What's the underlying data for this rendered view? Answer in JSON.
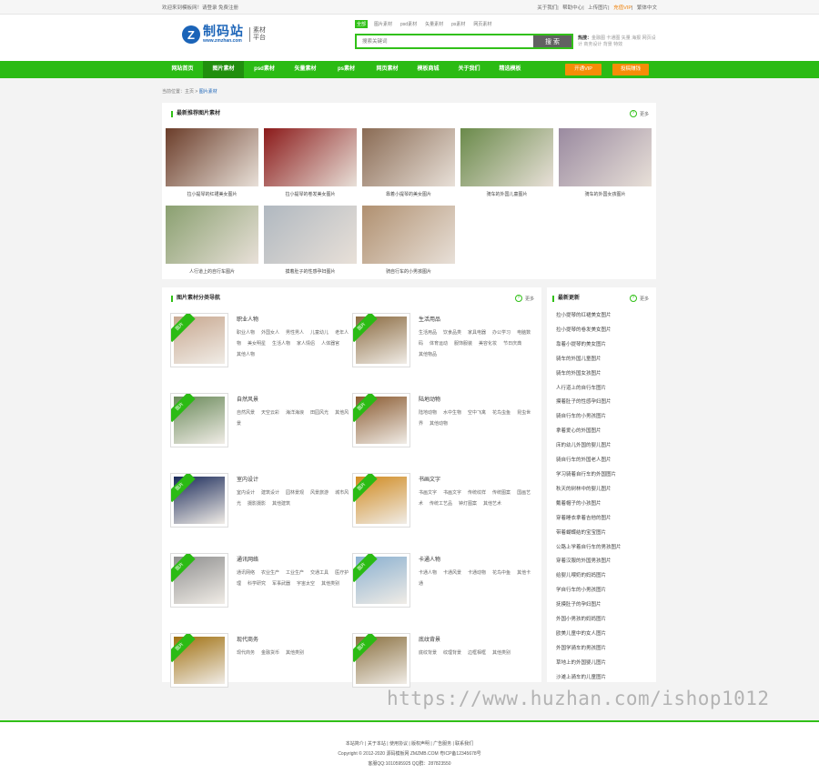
{
  "topbar": {
    "welcome": "欢迎来到模板网！请登录 免费注册",
    "links": [
      "关于我们",
      "帮助中心",
      "上传图片",
      "充值VIP",
      "繁体中文"
    ]
  },
  "logo": {
    "mark": "Z",
    "name": "制码站",
    "url": "www.zmzhan.com",
    "sub1": "素材",
    "sub2": "平台"
  },
  "search": {
    "tabs": [
      "全部",
      "图片素材",
      "psd素材",
      "矢量素材",
      "ps素材",
      "网页素材"
    ],
    "placeholder": "搜索关键词",
    "button": "搜 索"
  },
  "hot": {
    "label": "热搜：",
    "text": "金融图 卡通图 矢量 海报 网页设计 商务设计 背景 特效"
  },
  "nav": {
    "items": [
      "网站首页",
      "图片素材",
      "psd素材",
      "矢量素材",
      "ps素材",
      "网页素材",
      "模板商城",
      "关于我们",
      "精选模板"
    ],
    "btn1": "开通VIP",
    "btn2": "投稿赚钱"
  },
  "breadcrumb": {
    "home": "当前位置：主页",
    "sep": " > ",
    "current": "图片素材"
  },
  "rec": {
    "title": "最新推荐图片素材",
    "more": "更多",
    "items": [
      {
        "caption": "拉小提琴的红裙美女图片",
        "color": "#6b3d2a"
      },
      {
        "caption": "拉小提琴的卷发美女图片",
        "color": "#8b1a1a"
      },
      {
        "caption": "靠着小提琴的美女图片",
        "color": "#8a6b54"
      },
      {
        "caption": "骑车的外国儿童图片",
        "color": "#6a8a4a"
      },
      {
        "caption": "骑车的外国女孩图片",
        "color": "#9a8aa0"
      },
      {
        "caption": "人行道上的自行车图片",
        "color": "#8aa070"
      },
      {
        "caption": "摸着肚子的性感孕妇图片",
        "color": "#b0b8c0"
      },
      {
        "caption": "骑自行车的小男孩图片",
        "color": "#b09070"
      }
    ]
  },
  "cats": {
    "title": "图片素材分类导航",
    "more": "更多",
    "ribbon": "图片",
    "items": [
      {
        "name": "职业人物",
        "tags": [
          "职业人物",
          "外国女人",
          "男性男人",
          "儿童幼儿",
          "老年人物",
          "美女明星",
          "生活人物",
          "家人情侣",
          "人体器官",
          "其他人物"
        ],
        "color": "#c8a890"
      },
      {
        "name": "生活用品",
        "tags": [
          "生活用品",
          "饮食品类",
          "家具电器",
          "办公学习",
          "电脑数码",
          "体育运动",
          "服饰服装",
          "美容化妆",
          "节日庆典",
          "其他物品"
        ],
        "color": "#8a6a40"
      },
      {
        "name": "自然风景",
        "tags": [
          "自然风景",
          "天空云彩",
          "海洋海浪",
          "田园风光",
          "其他风景"
        ],
        "color": "#6a8a5a"
      },
      {
        "name": "陆地动物",
        "tags": [
          "陆地动物",
          "水中生物",
          "空中飞禽",
          "花鸟虫鱼",
          "昆虫世界",
          "其他动物"
        ],
        "color": "#8a5a30"
      },
      {
        "name": "室内设计",
        "tags": [
          "室内设计",
          "建筑设计",
          "园林景观",
          "风景旅游",
          "城市风光",
          "摄影摄影",
          "其他建筑"
        ],
        "color": "#1a2a5a"
      },
      {
        "name": "书画文字",
        "tags": [
          "书画文字",
          "书画文字",
          "传统纹样",
          "传统图案",
          "国画艺术",
          "传统工艺品",
          "钟灯图案",
          "其他艺术"
        ],
        "color": "#d08a20"
      },
      {
        "name": "通讯网络",
        "tags": [
          "通讯网络",
          "农业生产",
          "工业生产",
          "交通工具",
          "医疗护理",
          "科学研究",
          "军事武器",
          "宇宙太空",
          "其他类别"
        ],
        "color": "#909090"
      },
      {
        "name": "卡通人物",
        "tags": [
          "卡通人物",
          "卡通风景",
          "卡通动物",
          "花鸟中鱼",
          "其他卡通"
        ],
        "color": "#8ab0d0"
      },
      {
        "name": "现代商务",
        "tags": [
          "现代商务",
          "金融货币",
          "其他类别"
        ],
        "color": "#a07010"
      },
      {
        "name": "底纹背景",
        "tags": [
          "底纹背景",
          "纹理背景",
          "边框相框",
          "其他类别"
        ],
        "color": "#8a7040"
      }
    ]
  },
  "latest": {
    "title": "最新更新",
    "more": "更多",
    "items": [
      "拉小提琴的红裙美女图片",
      "拉小提琴的卷发美女图片",
      "靠着小提琴的美女图片",
      "骑车的外国儿童图片",
      "骑车的外国女孩图片",
      "人行道上的自行车图片",
      "摸着肚子的性感孕妇图片",
      "骑自行车的小男孩图片",
      "拿着爱心的外国图片",
      "床的幼儿外国的婴儿图片",
      "骑自行车的外国老人图片",
      "学习骑着自行车的外国图片",
      "秋天的树林中的婴儿图片",
      "戴着帽子的小孩图片",
      "穿着睡衣拿着吉他的图片",
      "带着蝴蝶结的宝宝图片",
      "公路上学着自行车的男孩图片",
      "穿着汉服的外国男孩图片",
      "给婴儿喂奶的妈妈图片",
      "学自行车的小男孩图片",
      "抚摸肚子的孕妇图片",
      "外国小男孩的妈妈图片",
      "欧美儿童中的女人图片",
      "外国学骑车的男孩图片",
      "草地上的外国婴儿图片",
      "沙滩上骑车的儿童图片"
    ]
  },
  "footer": {
    "links": "本站简介 | 关于本站 | 使用协议 | 版权声明 | 广告服务 | 联系我们",
    "copyright": "Copyright © 2012-2020 源码模板网 ZMZMB.COM 粤ICP备12345678号",
    "contact": "客服QQ:1010595925 QQ群：287823550"
  },
  "watermark": "https://www.huzhan.com/ishop1012"
}
